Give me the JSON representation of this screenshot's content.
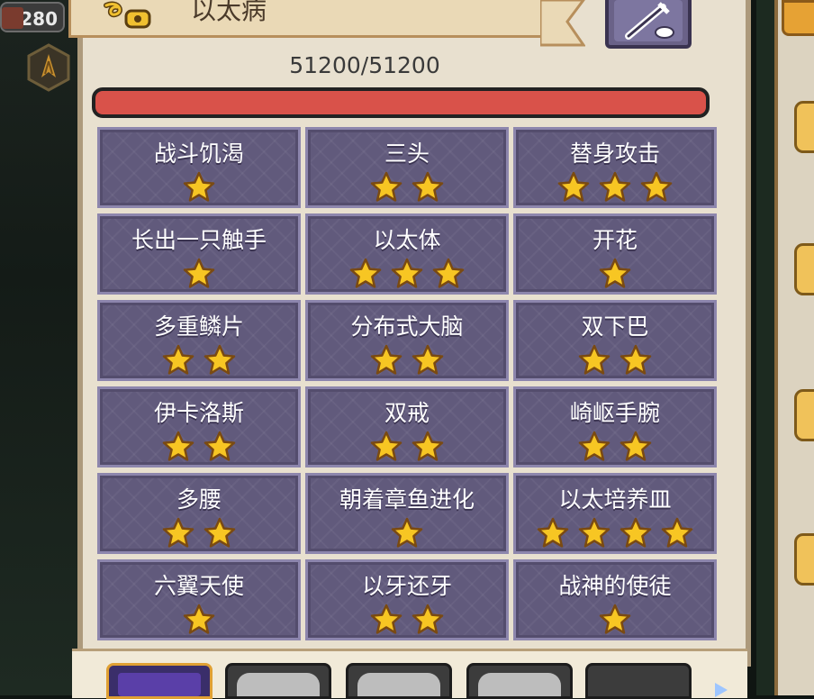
{
  "header": {
    "top_count": "280",
    "title": "以太病"
  },
  "hp": {
    "text": "51200/51200",
    "fill_fraction": 1.0
  },
  "colors": {
    "hp_fill": "#d9524a",
    "card_bg": "#615a7c",
    "star": "#f7c623"
  },
  "mutations": [
    {
      "name": "战斗饥渴",
      "stars": 1
    },
    {
      "name": "三头",
      "stars": 2
    },
    {
      "name": "替身攻击",
      "stars": 3
    },
    {
      "name": "长出一只触手",
      "stars": 1
    },
    {
      "name": "以太体",
      "stars": 3
    },
    {
      "name": "开花",
      "stars": 1
    },
    {
      "name": "多重鳞片",
      "stars": 2
    },
    {
      "name": "分布式大脑",
      "stars": 2
    },
    {
      "name": "双下巴",
      "stars": 2
    },
    {
      "name": "伊卡洛斯",
      "stars": 2
    },
    {
      "name": "双戒",
      "stars": 2
    },
    {
      "name": "崎岖手腕",
      "stars": 2
    },
    {
      "name": "多腰",
      "stars": 2
    },
    {
      "name": "朝着章鱼进化",
      "stars": 1
    },
    {
      "name": "以太培养皿",
      "stars": 4
    },
    {
      "name": "六翼天使",
      "stars": 1
    },
    {
      "name": "以牙还牙",
      "stars": 2
    },
    {
      "name": "战神的使徒",
      "stars": 1
    }
  ],
  "bottom_tabs": [
    {
      "icon": "purple-scroll-icon",
      "state": "active"
    },
    {
      "icon": "gray-item-icon",
      "state": "normal"
    },
    {
      "icon": "gray-item-icon",
      "state": "normal"
    },
    {
      "icon": "gray-item-icon",
      "state": "normal"
    },
    {
      "icon": "empty-slot-icon",
      "state": "empty"
    }
  ]
}
